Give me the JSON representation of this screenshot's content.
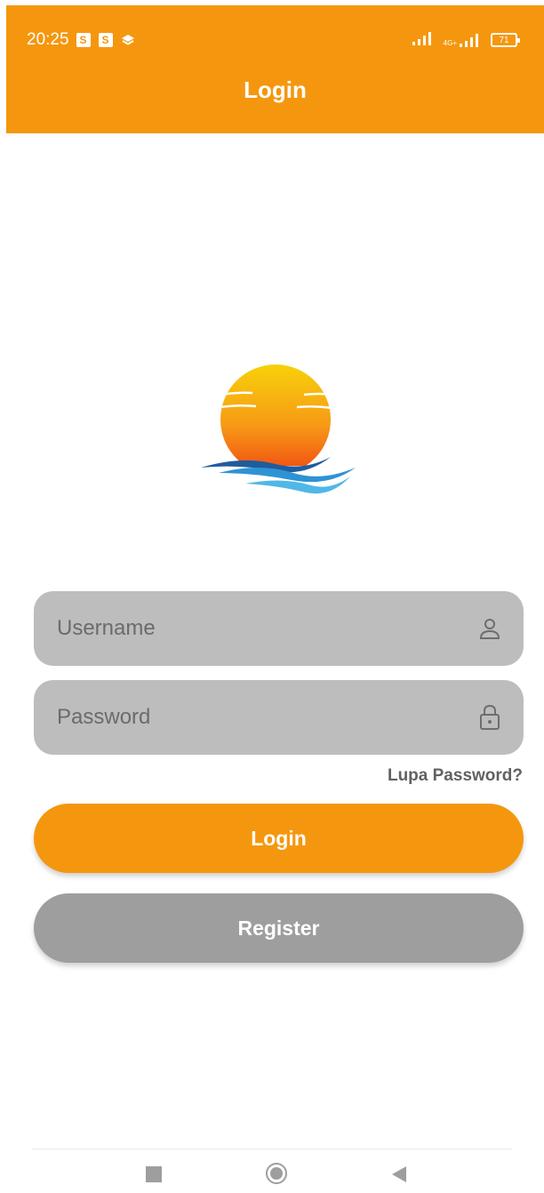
{
  "status_bar": {
    "time": "20:25",
    "battery": "71",
    "network_label": "4G+"
  },
  "header": {
    "title": "Login"
  },
  "form": {
    "username_placeholder": "Username",
    "password_placeholder": "Password",
    "forgot_password": "Lupa Password?",
    "login_button": "Login",
    "register_button": "Register"
  },
  "colors": {
    "primary": "#F5970E",
    "field_bg": "#BDBDBD",
    "secondary_button": "#9E9E9E"
  },
  "icons": {
    "username": "person-icon",
    "password": "lock-icon",
    "nav_recent": "square-icon",
    "nav_home": "circle-icon",
    "nav_back": "back-triangle-icon"
  }
}
